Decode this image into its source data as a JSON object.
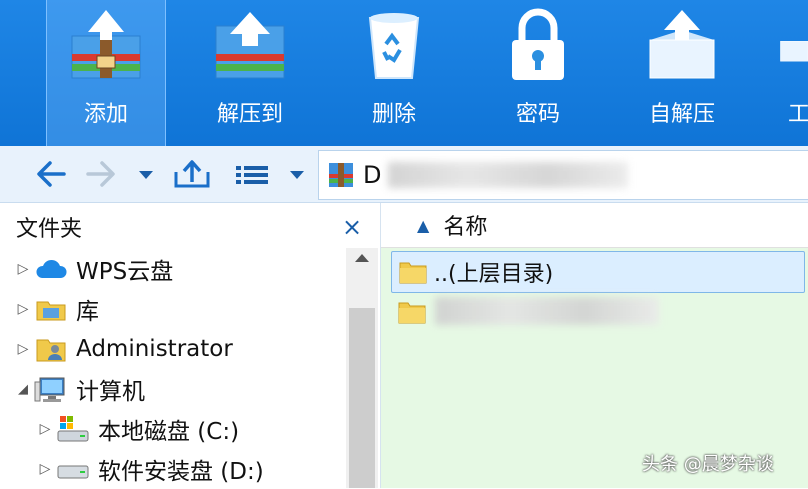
{
  "toolbar": {
    "buttons": [
      {
        "label": "添加",
        "icon": "add-archive-icon"
      },
      {
        "label": "解压到",
        "icon": "extract-to-icon"
      },
      {
        "label": "删除",
        "icon": "recycle-bin-icon"
      },
      {
        "label": "密码",
        "icon": "lock-icon"
      },
      {
        "label": "自解压",
        "icon": "self-extract-icon"
      },
      {
        "label": "工",
        "icon": "tools-icon"
      }
    ]
  },
  "address": {
    "path": "D"
  },
  "left_panel": {
    "title": "文件夹",
    "close": "×",
    "tree": [
      {
        "label": "WPS云盘",
        "icon": "cloud-icon"
      },
      {
        "label": "库",
        "icon": "library-icon"
      },
      {
        "label": "Administrator",
        "icon": "user-folder-icon"
      },
      {
        "label": "计算机",
        "icon": "computer-icon"
      },
      {
        "label": "本地磁盘 (C:)",
        "icon": "system-drive-icon"
      },
      {
        "label": "软件安装盘 (D:)",
        "icon": "drive-icon"
      }
    ]
  },
  "file_list": {
    "column_name": "名称",
    "rows": [
      {
        "label": "..(上层目录)"
      }
    ]
  },
  "watermark": "头条 @晨梦杂谈",
  "colors": {
    "toolbar": "#1279dc",
    "list_bg": "#e6f9e4",
    "accent": "#1a5ea8"
  }
}
